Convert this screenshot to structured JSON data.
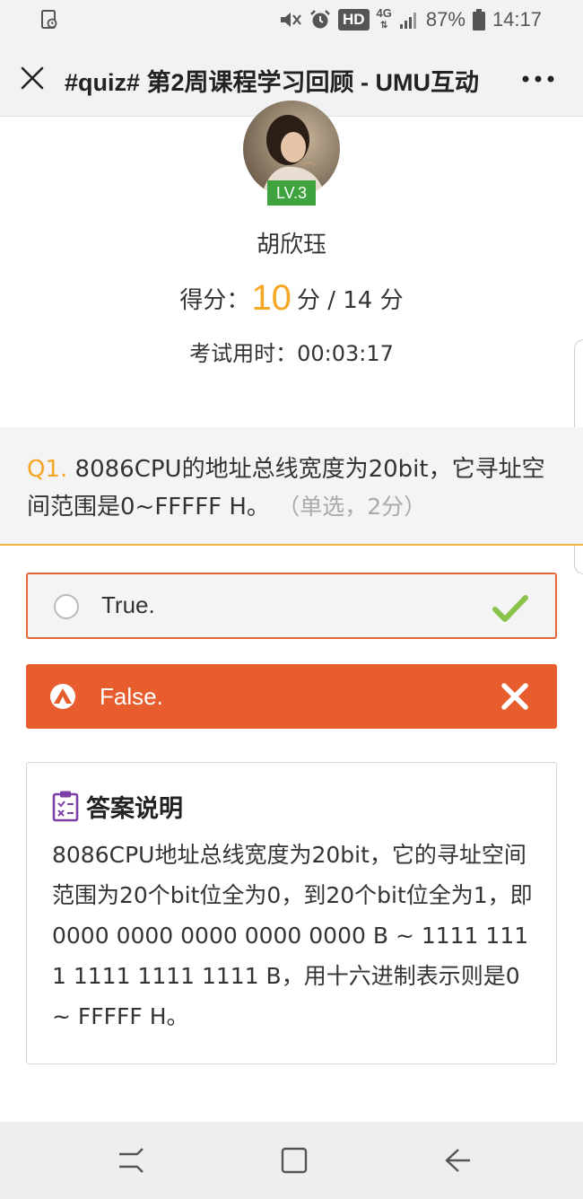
{
  "status_bar": {
    "hd": "HD",
    "network": "4G",
    "battery_percent": "87%",
    "time": "14:17",
    "icons": [
      "screenshot-icon",
      "mute-icon",
      "alarm-icon",
      "signal-icon",
      "battery-icon"
    ]
  },
  "title_bar": {
    "title": "#quiz# 第2周课程学习回顾 - UMU互动",
    "close_icon": "close-icon",
    "more_icon": "more-icon"
  },
  "profile": {
    "level": "LV.3",
    "name": "胡欣珏",
    "score_label": "得分：",
    "score_value": "10",
    "score_suffix": "分 / 14 分",
    "time_label": "考试用时：",
    "time_value": "00:03:17"
  },
  "question": {
    "number": "Q1.",
    "text": "8086CPU的地址总线宽度为20bit，它寻址空间范围是0~FFFFF H。",
    "meta": "（单选，2分）"
  },
  "options": [
    {
      "label": "True.",
      "state": "correct-unselected",
      "icon": "check-icon"
    },
    {
      "label": "False.",
      "state": "selected-wrong",
      "icon": "x-icon"
    }
  ],
  "colors": {
    "accent_orange": "#f5a623",
    "wrong_red": "#e85d2e",
    "check_green": "#8bc34a",
    "level_green": "#3ea33e",
    "explanation_icon": "#7b3fa6"
  },
  "explanation": {
    "title": "答案说明",
    "text": "8086CPU地址总线宽度为20bit，它的寻址空间范围为20个bit位全为0，到20个bit位全为1，即0000 0000 0000 0000 0000 B ~ 1111 1111 1111 1111 1111 B，用十六进制表示则是0 ~ FFFFF H。"
  },
  "nav_bar": {
    "icons": [
      "recents-icon",
      "home-icon",
      "back-icon"
    ]
  }
}
